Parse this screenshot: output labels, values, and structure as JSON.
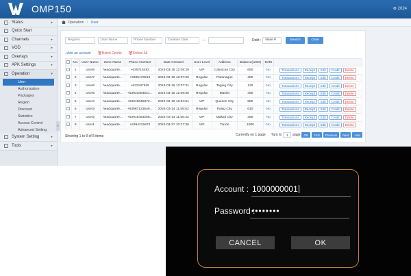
{
  "app": {
    "title": "OMP150",
    "top_right": "⚙ 2024"
  },
  "sidebar": {
    "items": [
      {
        "label": "Status",
        "chev": "▸"
      },
      {
        "label": "Quick Start",
        "chev": ""
      },
      {
        "label": "Channels",
        "chev": "▸"
      },
      {
        "label": "VOD",
        "chev": "▸"
      },
      {
        "label": "Overlays",
        "chev": "▸"
      },
      {
        "label": "APK Settings",
        "chev": "▸"
      },
      {
        "label": "Operation",
        "chev": "▾"
      }
    ],
    "sub_items": [
      "User",
      "Authorization",
      "Packages",
      "Region",
      "Discount",
      "Statistics",
      "Access Control",
      "Advanced Setting"
    ],
    "bottom_items": [
      {
        "label": "System Setting",
        "chev": "▸"
      },
      {
        "label": "Tools",
        "chev": "▸"
      }
    ],
    "collapse": "«"
  },
  "breadcrumb": {
    "section": "Operation",
    "current": "User"
  },
  "filters": {
    "regions_ph": "Regions",
    "username_ph": "User Name",
    "phone_ph": "Phone Number",
    "created_ph": "Creation Date",
    "dash": "—",
    "debt_label": "Debt :",
    "debt_value": "None ▾",
    "search": "Search",
    "clear": "Clear"
  },
  "actions": {
    "add": "+Add an account",
    "batch_delete": "🗑Batch Delete",
    "delete_all": "🗑Delete All"
  },
  "table": {
    "headers": [
      "No.",
      "User Name",
      "Zone Name",
      "Phone Number",
      "Date Created",
      "User Level",
      "Address",
      "Balance(USD)",
      "Debt"
    ],
    "rows": [
      [
        "1",
        "User8",
        "headquarte...",
        "+639715482",
        "2024-03-15 12:08:29",
        "VIP",
        "Caloocan City",
        "650",
        "No"
      ],
      [
        "2",
        "User7",
        "headquarte...",
        "+6395178214",
        "2024-03-15 12:07:59",
        "Regular",
        "Paranaque",
        "400",
        "No"
      ],
      [
        "3",
        "User6",
        "headquarte...",
        "+632187925",
        "2024-03-15 12:07:31",
        "Regular",
        "Taguig City",
        "120",
        "No"
      ],
      [
        "4",
        "User5",
        "headquarte...",
        "+63931684521...",
        "2024-03-15 12:06:58",
        "Regular",
        "Manila",
        "450",
        "No"
      ],
      [
        "5",
        "User4",
        "headquarte...",
        "+63919645872...",
        "2024-03-15 12:04:51",
        "VIP",
        "Quezon City",
        "980",
        "No"
      ],
      [
        "6",
        "User3",
        "headquarte...",
        "+63987123549...",
        "2024-03-14 11:55:52",
        "Regular",
        "Pasig City",
        "610",
        "No"
      ],
      [
        "7",
        "User2",
        "headquarte...",
        "+63915463258...",
        "2024-03-14 11:55:42",
        "VIP",
        "Makati City",
        "350",
        "No"
      ],
      [
        "8",
        "User1",
        "headquarte...",
        "+6394215874",
        "2024-03-27 10:37:36",
        "VIP",
        "Tondo",
        "1000",
        "No"
      ]
    ],
    "row_actions": [
      "Transactions",
      "Receipt",
      "Edit",
      "Credit",
      "Delete"
    ]
  },
  "footer": {
    "showing": "Showing 1 to 8 of 8 items",
    "currently": "Currently on 1 page",
    "turn_to": "Turn to",
    "page_input": "1",
    "page_word": "page",
    "ok": "OK",
    "first": "First",
    "previous": "Previous",
    "next": "Next",
    "last": "Last"
  },
  "dialog": {
    "account_label": "Account :",
    "account_value": "1000000001",
    "password_label": "Password :",
    "password_value": "••••••••",
    "cancel": "CANCEL",
    "ok": "OK",
    "border_color": "#c08035"
  },
  "colors": {
    "topbar": "#1d5796",
    "accent": "#2f77c1",
    "danger": "#d9534f"
  }
}
